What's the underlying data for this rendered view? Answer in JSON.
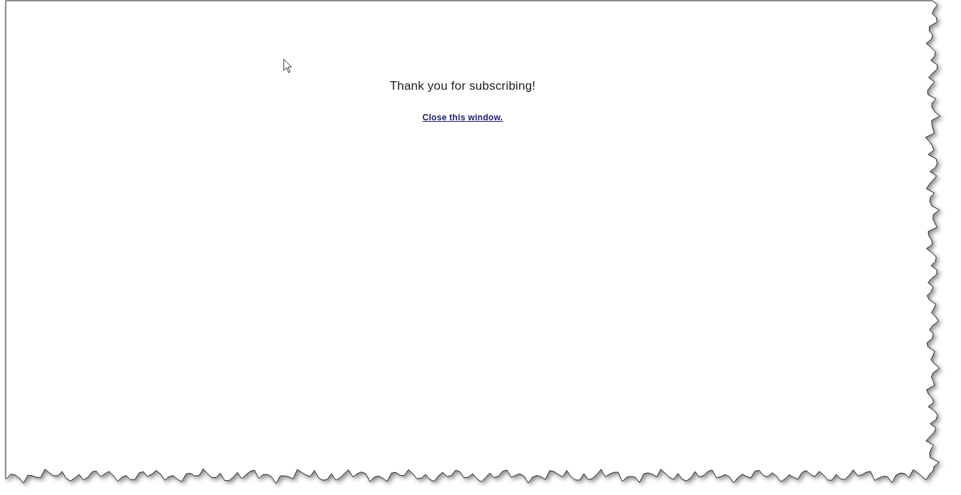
{
  "message": "Thank you for subscribing!",
  "link": "Close this window."
}
